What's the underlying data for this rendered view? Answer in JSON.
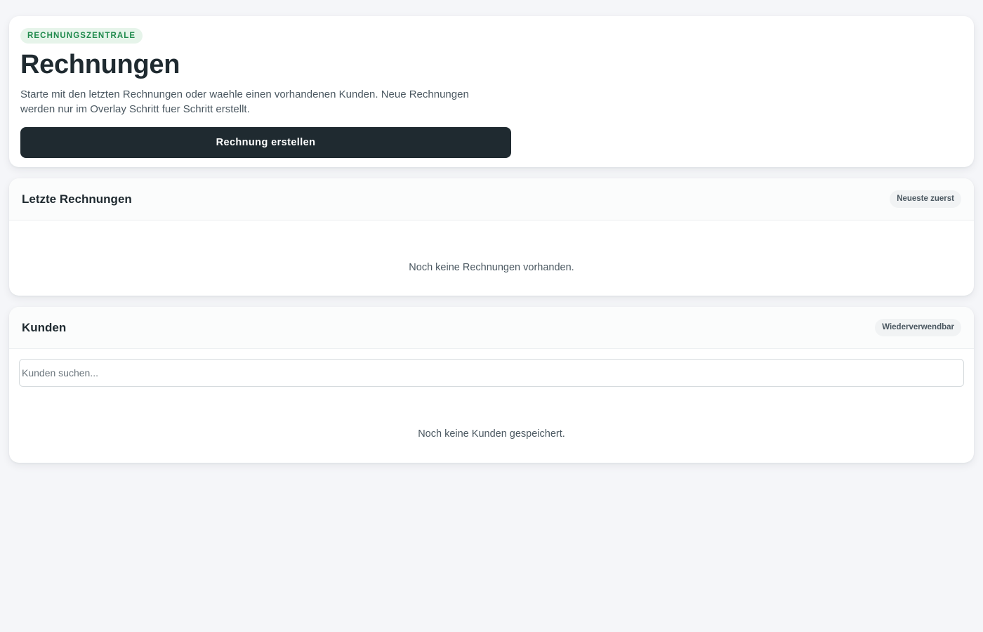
{
  "hero": {
    "eyebrow": "RECHNUNGSZENTRALE",
    "title": "Rechnungen",
    "description": "Starte mit den letzten Rechnungen oder waehle einen vorhandenen Kunden. Neue Rechnungen werden nur im Overlay Schritt fuer Schritt erstellt.",
    "create_button_label": "Rechnung erstellen"
  },
  "invoices": {
    "title": "Letzte Rechnungen",
    "sort_badge": "Neueste zuerst",
    "empty_message": "Noch keine Rechnungen vorhanden."
  },
  "customers": {
    "title": "Kunden",
    "badge": "Wiederverwendbar",
    "search_placeholder": "Kunden suchen...",
    "search_value": "",
    "empty_message": "Noch keine Kunden gespeichert."
  },
  "colors": {
    "background": "#f5f6f9",
    "primary": "#1f2a30",
    "eyebrow_text": "#1f8a4c",
    "eyebrow_bg": "#e6f4ea",
    "muted_text": "#4b5861"
  }
}
